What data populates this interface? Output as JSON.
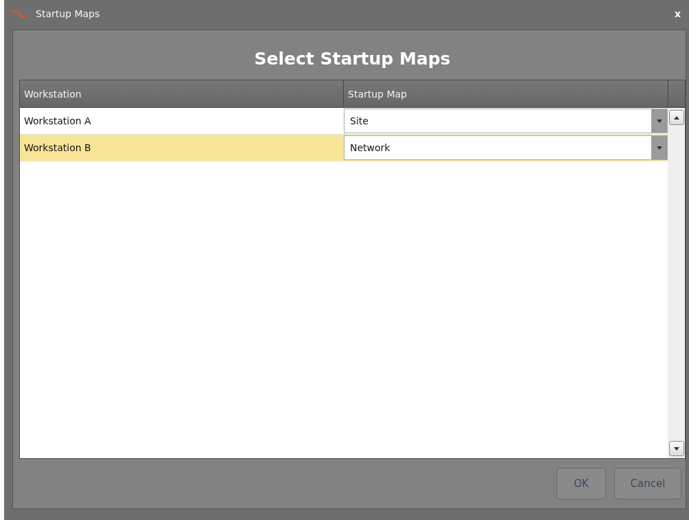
{
  "window": {
    "title": "Startup Maps",
    "close": "x"
  },
  "heading": "Select Startup Maps",
  "table": {
    "columns": [
      "Workstation",
      "Startup Map"
    ],
    "rows": [
      {
        "workstation": "Workstation A",
        "startup_map": "Site",
        "selected": false
      },
      {
        "workstation": "Workstation B",
        "startup_map": "Network",
        "selected": true
      }
    ]
  },
  "buttons": [
    "OK",
    "Cancel"
  ]
}
